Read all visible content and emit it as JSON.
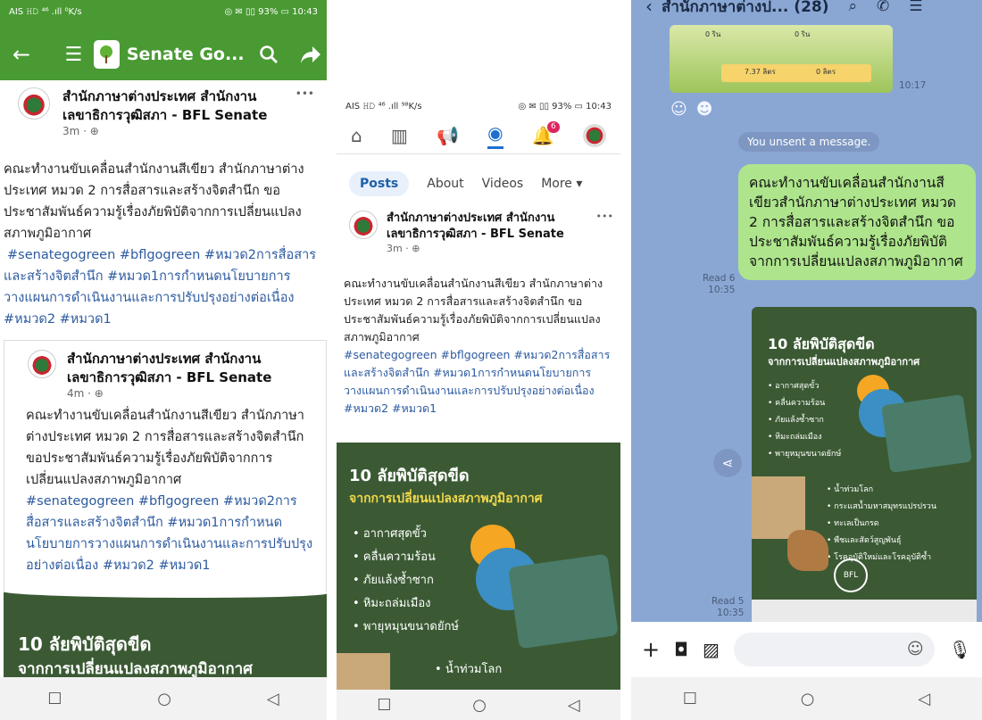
{
  "p1": {
    "statusbar": {
      "left": "AIS 𝙷𝙳 ⁴⁶ .ıll ⁰K/s",
      "right": "◎ ✉ ▯▯ 93% ▭ 10:43"
    },
    "header": {
      "title": "Senate Go...",
      "bg": "#4a9a34"
    },
    "post": {
      "author": "สำนักภาษาต่างประเทศ สำนักงาน เลขาธิการวุฒิสภา - BFL Senate",
      "time": "3m · ⊕",
      "menu": "•••",
      "text": "คณะทำงานขับเคลื่อนสำนักงานสีเขียว สำนักภาษาต่างประเทศ หมวด 2 การสื่อสารและสร้างจิตสำนึก ขอประชาสัมพันธ์ความรู้เรื่องภัยพิบัติจากการเปลี่ยนแปลงสภาพภูมิอากาศ",
      "tags": "#senategogreen #bflgogreen #หมวด2การสื่อสารและสร้างจิตสำนึก #หมวด1การกำหนดนโยบายการวางแผนการดำเนินงานและการปรับปรุงอย่างต่อเนื่อง #หมวด2 #หมวด1"
    },
    "shared": {
      "author": "สำนักภาษาต่างประเทศ สำนักงาน เลขาธิการวุฒิสภา - BFL Senate",
      "time": "4m · ⊕",
      "text": "คณะทำงานขับเคลื่อนสำนักงานสีเขียว สำนักภาษาต่างประเทศ หมวด 2 การสื่อสารและสร้างจิตสำนึก ขอประชาสัมพันธ์ความรู้เรื่องภัยพิบัติจากการเปลี่ยนแปลงสภาพภูมิอากาศ",
      "tags": "#senategogreen #bflgogreen #หมวด2การสื่อสารและสร้างจิตสำนึก #หมวด1การกำหนดนโยบายการวางแผนการดำเนินงานและการปรับปรุงอย่างต่อเนื่อง #หมวด2 #หมวด1"
    },
    "image": {
      "title": "10 ลัยพิบัติสุดขีด",
      "sub": "จากการเปลี่ยนแปลงสภาพภูมิอากาศ"
    }
  },
  "p2": {
    "statusbar": {
      "left": "AIS 𝙷𝙳 ⁴⁶ .ıll ⁹⁸K/s",
      "right": "◎ ✉ ▯▯ 93% ▭ 10:43"
    },
    "badge": "6",
    "tabs": {
      "posts": "Posts",
      "about": "About",
      "videos": "Videos",
      "more": "More ▾"
    },
    "post": {
      "author": "สำนักภาษาต่างประเทศ สำนักงาน เลขาธิการวุฒิสภา - BFL Senate",
      "time": "3m · ⊕",
      "menu": "•••",
      "text": "คณะทำงานขับเคลื่อนสำนักงานสีเขียว สำนักภาษาต่างประเทศ หมวด 2 การสื่อสารและสร้างจิตสำนึก ขอประชาสัมพันธ์ความรู้เรื่องภัยพิบัติจากการเปลี่ยนแปลงสภาพภูมิอากาศ",
      "tags": "#senategogreen #bflgogreen #หมวด2การสื่อสารและสร้างจิตสำนึก #หมวด1การกำหนดนโยบายการวางแผนการดำเนินงานและการปรับปรุงอย่างต่อเนื่อง #หมวด2 #หมวด1"
    },
    "image": {
      "title": "10 ลัยพิบัติสุดขีด",
      "sub": "จากการเปลี่ยนแปลงสภาพภูมิอากาศ",
      "bullets": [
        "อากาศสุดขั้ว",
        "คลื่นความร้อน",
        "ภัยแล้งซ้ำซาก",
        "หิมะถล่มเมือง",
        "พายุหมุนขนาดยักษ์"
      ],
      "bullet2": "น้ำท่วมโลก"
    }
  },
  "p3": {
    "header": {
      "title": "สำนักภาษาต่างป... (28)"
    },
    "top_image": {
      "labels": [
        "0 ริน",
        "0 ริน",
        "7.37 ลิตร",
        "0 ลิตร"
      ],
      "time": "10:17"
    },
    "unsent": "You unsent a message.",
    "msg": {
      "text": "คณะทำงานขับเคลื่อนสำนักงานสีเขียวสำนักภาษาต่างประเทศ หมวด 2 การสื่อสารและสร้างจิตสำนึก ขอประชาสัมพันธ์ความรู้เรื่องภัยพิบัติจากการเปลี่ยนแปลงสภาพภูมิอากาศ",
      "read": "Read 6",
      "time": "10:35"
    },
    "poster": {
      "title": "10 ลัยพิบัติสุดขีด",
      "sub": "จากการเปลี่ยนแปลงสภาพภูมิอากาศ",
      "bullets": [
        "อากาศสุดขั้ว",
        "คลื่นความร้อน",
        "ภัยแล้งซ้ำซาก",
        "หิมะถล่มเมือง",
        "พายุหมุนขนาดยักษ์"
      ],
      "bullets2": [
        "น้ำท่วมโลก",
        "กระแสน้ำมหาสมุทรแปรปรวน",
        "ทะเลเป็นกรด",
        "พืชและสัตว์สูญพันธุ์",
        "โรคอุบัติใหม่และโรคอุบัติซ้ำ"
      ],
      "logo": "BFL",
      "read": "Read 5",
      "time": "10:35"
    }
  }
}
